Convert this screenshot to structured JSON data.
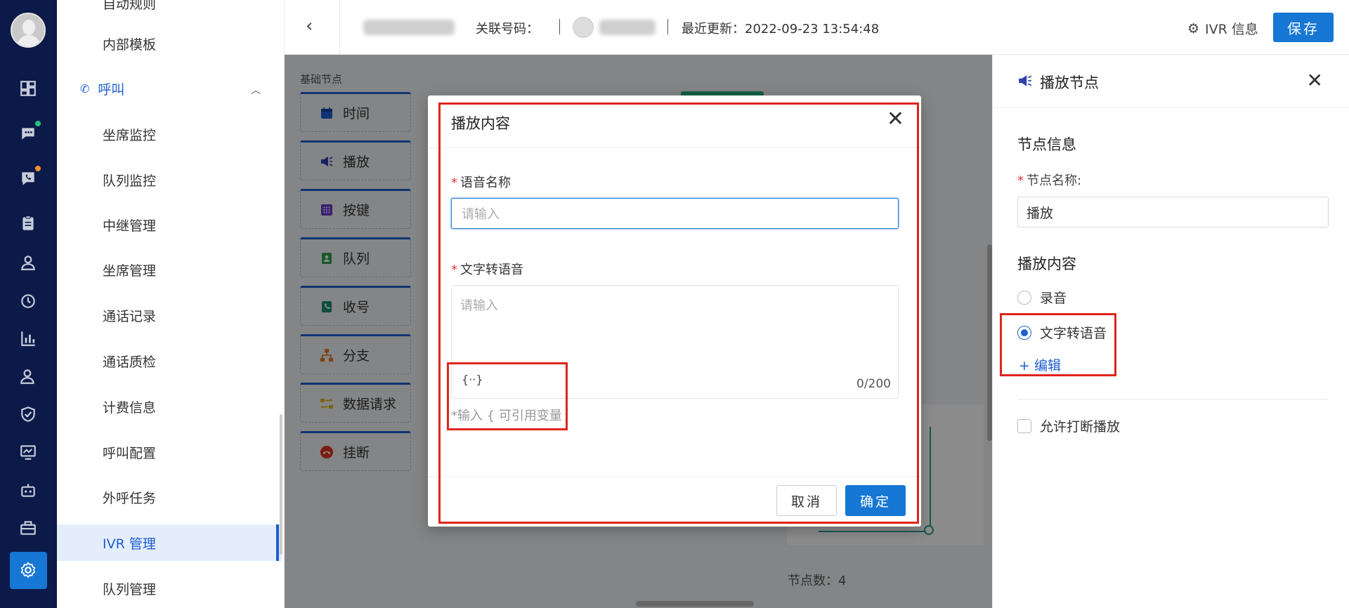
{
  "sidebar": {
    "menu_items": [
      {
        "label": "自动规则"
      },
      {
        "label": "内部模板"
      },
      {
        "label": "坐席监控"
      },
      {
        "label": "队列监控"
      },
      {
        "label": "中继管理"
      },
      {
        "label": "坐席管理"
      },
      {
        "label": "通话记录"
      },
      {
        "label": "通话质检"
      },
      {
        "label": "计费信息"
      },
      {
        "label": "呼叫配置"
      },
      {
        "label": "外呼任务"
      },
      {
        "label": "IVR 管理"
      },
      {
        "label": "队列管理"
      }
    ],
    "group": {
      "label": "呼叫",
      "icon": "phone-icon"
    },
    "active_item": "IVR 管理",
    "colors": {
      "rail_bg": "#0c1a4a",
      "active": "#1e5fd0"
    }
  },
  "header": {
    "back_icon": "back-icon",
    "related_number_label": "关联号码：",
    "last_updated": "最近更新：2022-09-23 13:54:48",
    "ivr_info_label": "IVR 信息",
    "save_label": "保存"
  },
  "palette": {
    "title": "基础节点",
    "nodes": [
      {
        "label": "时间",
        "icon": "calendar-icon"
      },
      {
        "label": "播放",
        "icon": "speaker-icon"
      },
      {
        "label": "按键",
        "icon": "keypad-icon"
      },
      {
        "label": "队列",
        "icon": "queue-icon"
      },
      {
        "label": "收号",
        "icon": "collect-digits-icon"
      },
      {
        "label": "分支",
        "icon": "branch-icon"
      },
      {
        "label": "数据请求",
        "icon": "data-request-icon"
      },
      {
        "label": "挂断",
        "icon": "hangup-icon"
      }
    ]
  },
  "canvas": {
    "node_count": "节点数：4"
  },
  "panel": {
    "title": "播放节点",
    "node_info_title": "节点信息",
    "node_name_label": "节点名称:",
    "node_name_value": "播放",
    "play_content_title": "播放内容",
    "options": [
      {
        "label": "录音",
        "selected": false
      },
      {
        "label": "文字转语音",
        "selected": true
      }
    ],
    "edit_link": "+ 编辑",
    "allow_interrupt_label": "允许打断播放"
  },
  "modal": {
    "title": "播放内容",
    "voice_name_label": "语音名称",
    "voice_name_placeholder": "请输入",
    "tts_label": "文字转语音",
    "tts_placeholder": "请输入",
    "var_button": "{··}",
    "counter": "0/200",
    "hint": "*输入 { 可引用变量",
    "cancel_label": "取消",
    "ok_label": "确定"
  }
}
